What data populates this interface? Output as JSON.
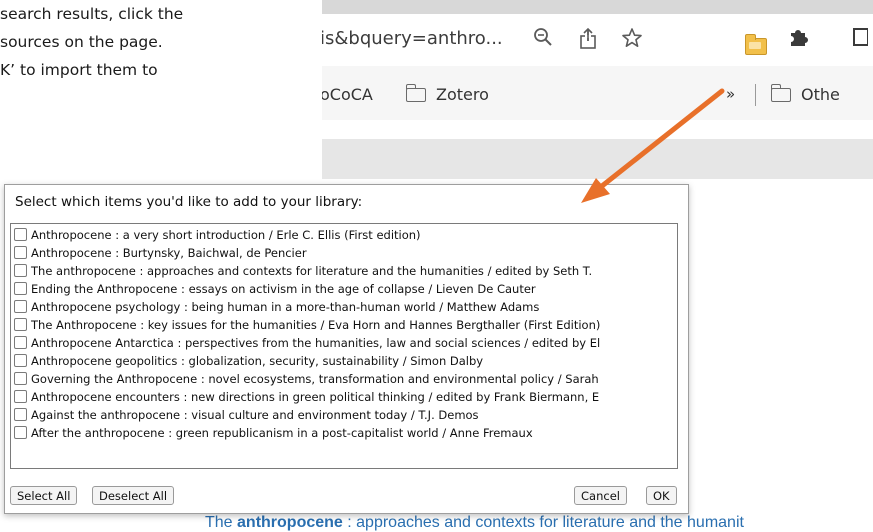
{
  "instructions": {
    "lines": [
      "search results, click the",
      "sources on the page.",
      "K’ to import them to"
    ]
  },
  "browser": {
    "url": "is&bquery=anthro...",
    "toolbar_icons": [
      "zoom-icon",
      "share-icon",
      "star-icon",
      "zotero-folder-icon",
      "extensions-icon"
    ],
    "bookmarks": {
      "item1": "oCoCA",
      "item2": "Zotero",
      "more": "»",
      "other": "Othe"
    }
  },
  "dialog": {
    "title": "Select which items you'd like to add to your library:",
    "items": [
      "Anthropocene : a very short introduction / Erle C. Ellis (First edition)",
      "Anthropocene : Burtynsky, Baichwal, de Pencier",
      "The anthropocene : approaches and contexts for literature and the humanities / edited by Seth T.",
      "Ending the Anthropocene : essays on activism in the age of collapse / Lieven De Cauter",
      "Anthropocene psychology : being human in a more-than-human world / Matthew Adams",
      "The Anthropocene : key issues for the humanities / Eva Horn and Hannes Bergthaller (First Edition)",
      "Anthropocene Antarctica : perspectives from the humanities, law and social sciences / edited by El",
      "Anthropocene geopolitics : globalization, security, sustainability / Simon Dalby",
      "Governing the Anthropocene : novel ecosystems, transformation and environmental policy / Sarah",
      "Anthropocene encounters : new directions in green political thinking / edited by Frank Biermann, E",
      "Against the anthropocene : visual culture and environment today / T.J. Demos",
      "After the anthropocene : green republicanism in a post-capitalist world / Anne Fremaux"
    ],
    "buttons": {
      "select_all": "Select All",
      "deselect_all": "Deselect All",
      "cancel": "Cancel",
      "ok": "OK"
    }
  },
  "background_page": {
    "link_prefix": "The ",
    "link_bold": "anthropocene",
    "link_rest": " : approaches and contexts for literature and the humanit"
  },
  "colors": {
    "arrow": "#e8702a",
    "link": "#2a6fb0"
  }
}
